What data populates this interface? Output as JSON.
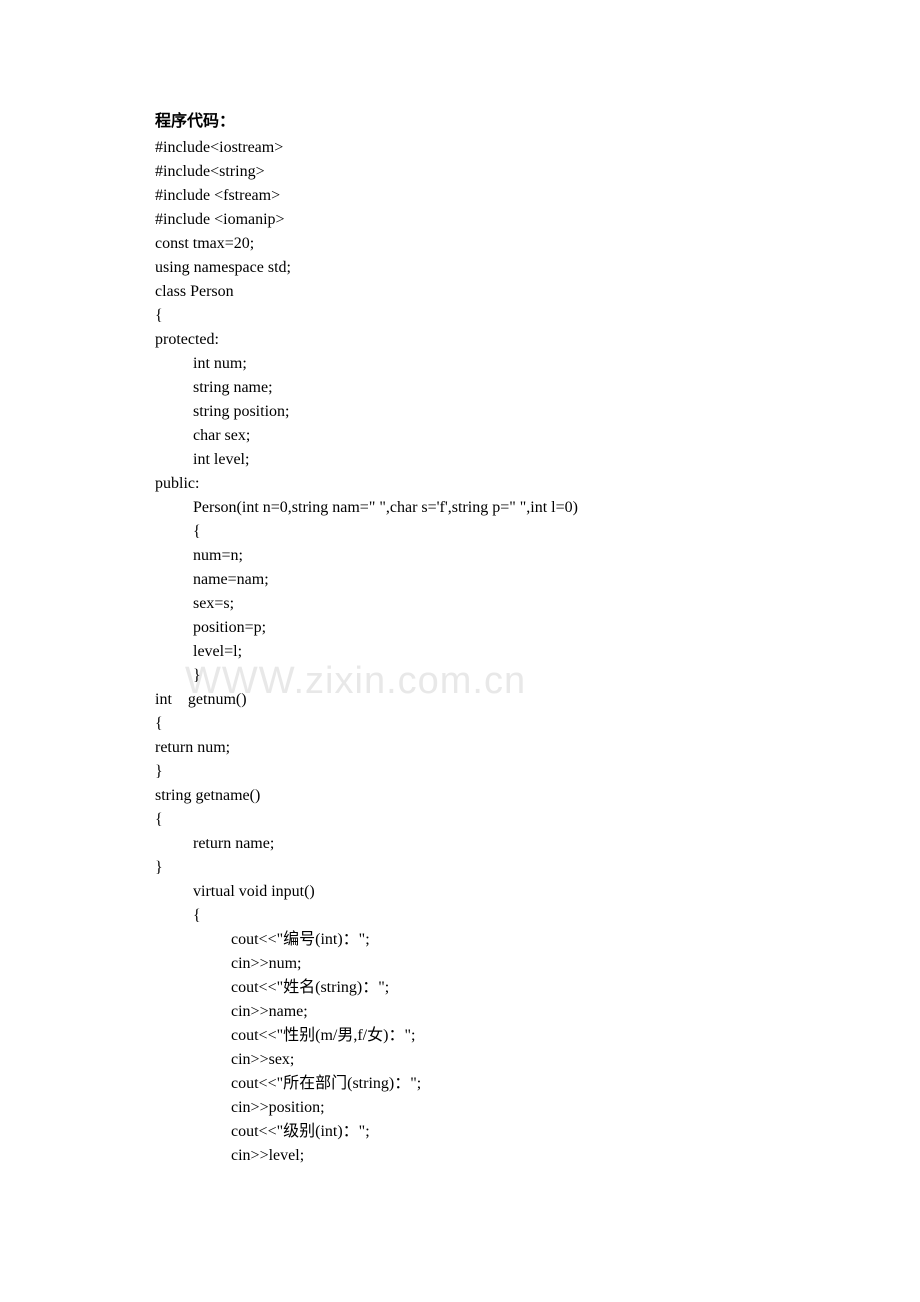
{
  "heading": "程序代码：",
  "watermark": "WWW.zixin.com.cn",
  "code": {
    "lines": [
      {
        "text": "#include<iostream>",
        "indent": 0
      },
      {
        "text": "#include<string>",
        "indent": 0
      },
      {
        "text": "#include <fstream>",
        "indent": 0
      },
      {
        "text": "#include <iomanip>",
        "indent": 0
      },
      {
        "text": "const tmax=20;",
        "indent": 0
      },
      {
        "text": "using namespace std;",
        "indent": 0
      },
      {
        "text": "class Person",
        "indent": 0
      },
      {
        "text": "{",
        "indent": 0
      },
      {
        "text": "protected:",
        "indent": 0
      },
      {
        "text": "int num;",
        "indent": 1
      },
      {
        "text": "string name;",
        "indent": 1
      },
      {
        "text": "string position;",
        "indent": 1
      },
      {
        "text": "char sex;",
        "indent": 1
      },
      {
        "text": "int level;",
        "indent": 1
      },
      {
        "text": "public:",
        "indent": 0
      },
      {
        "text": "Person(int n=0,string nam=\" \",char s='f',string p=\" \",int l=0)",
        "indent": 1
      },
      {
        "text": "{",
        "indent": 1
      },
      {
        "text": "num=n;",
        "indent": 1
      },
      {
        "text": "name=nam;",
        "indent": 1
      },
      {
        "text": "sex=s;",
        "indent": 1
      },
      {
        "text": "position=p;",
        "indent": 1
      },
      {
        "text": "level=l;",
        "indent": 1
      },
      {
        "text": "}",
        "indent": 1
      },
      {
        "text": "int    getnum()",
        "indent": 0
      },
      {
        "text": "{",
        "indent": 0
      },
      {
        "text": "return num;",
        "indent": 0
      },
      {
        "text": "}",
        "indent": 0
      },
      {
        "text": "string getname()",
        "indent": 0
      },
      {
        "text": "{",
        "indent": 0
      },
      {
        "text": "return name;",
        "indent": 1
      },
      {
        "text": "}",
        "indent": 0
      },
      {
        "text": "virtual void input()",
        "indent": 1
      },
      {
        "text": "{",
        "indent": 1
      },
      {
        "text": "cout<<\"编号(int)：\";",
        "indent": 2
      },
      {
        "text": "cin>>num;",
        "indent": 2
      },
      {
        "text": "cout<<\"姓名(string)：\";",
        "indent": 2
      },
      {
        "text": "cin>>name;",
        "indent": 2
      },
      {
        "text": "cout<<\"性别(m/男,f/女)：\";",
        "indent": 2
      },
      {
        "text": "cin>>sex;",
        "indent": 2
      },
      {
        "text": "cout<<\"所在部门(string)：\";",
        "indent": 2
      },
      {
        "text": "cin>>position;",
        "indent": 2
      },
      {
        "text": "cout<<\"级别(int)：\";",
        "indent": 2
      },
      {
        "text": "cin>>level;",
        "indent": 2
      }
    ]
  }
}
